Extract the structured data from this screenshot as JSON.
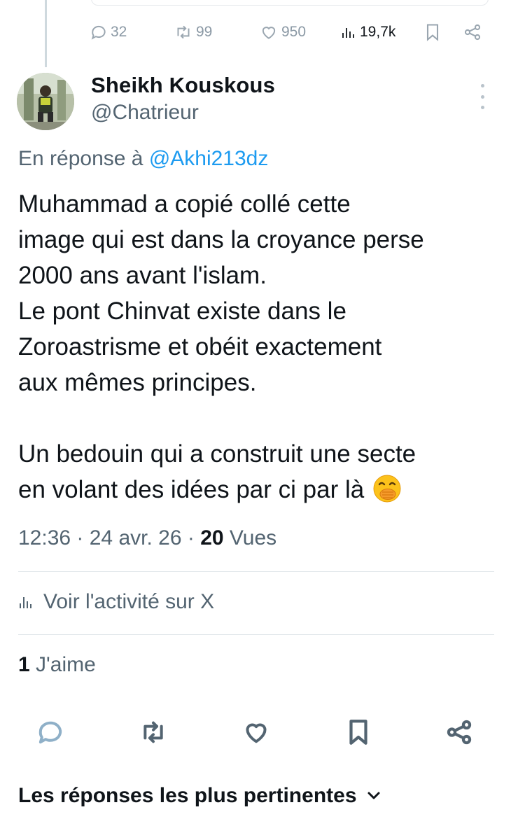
{
  "previous_tweet": {
    "replies": "32",
    "reposts": "99",
    "likes": "950",
    "views": "19,7k"
  },
  "tweet": {
    "author_name": "Sheikh Kouskous",
    "author_handle": "@Chatrieur",
    "reply_prefix": "En réponse à",
    "reply_to": "@Akhi213dz",
    "lines": [
      "Muhammad a copié collé cette",
      "image qui est dans la croyance perse",
      "2000 ans avant l'islam.",
      "Le pont Chinvat existe dans le",
      "Zoroastrisme et obéit exactement",
      "aux mêmes principes.",
      "",
      "Un bedouin qui a construit une secte",
      "en volant des idées par ci par là"
    ],
    "emoji": "face-with-hand-over-mouth",
    "time": "12:36",
    "date": "24 avr. 26",
    "views_count": "20",
    "views_label": "Vues",
    "activity_label": "Voir l'activité sur X",
    "likes_count": "1",
    "likes_label": "J'aime"
  },
  "actions": {
    "reply_icon": "comment-icon",
    "repost_icon": "repost-icon",
    "like_icon": "heart-icon",
    "bookmark_icon": "bookmark-icon",
    "share_icon": "share-icon"
  },
  "replies_section": {
    "label": "Les réponses les plus pertinentes"
  },
  "colors": {
    "link": "#1d9bf0",
    "muted": "#536471",
    "text": "#0f1419",
    "divider": "#e3e8ec"
  }
}
